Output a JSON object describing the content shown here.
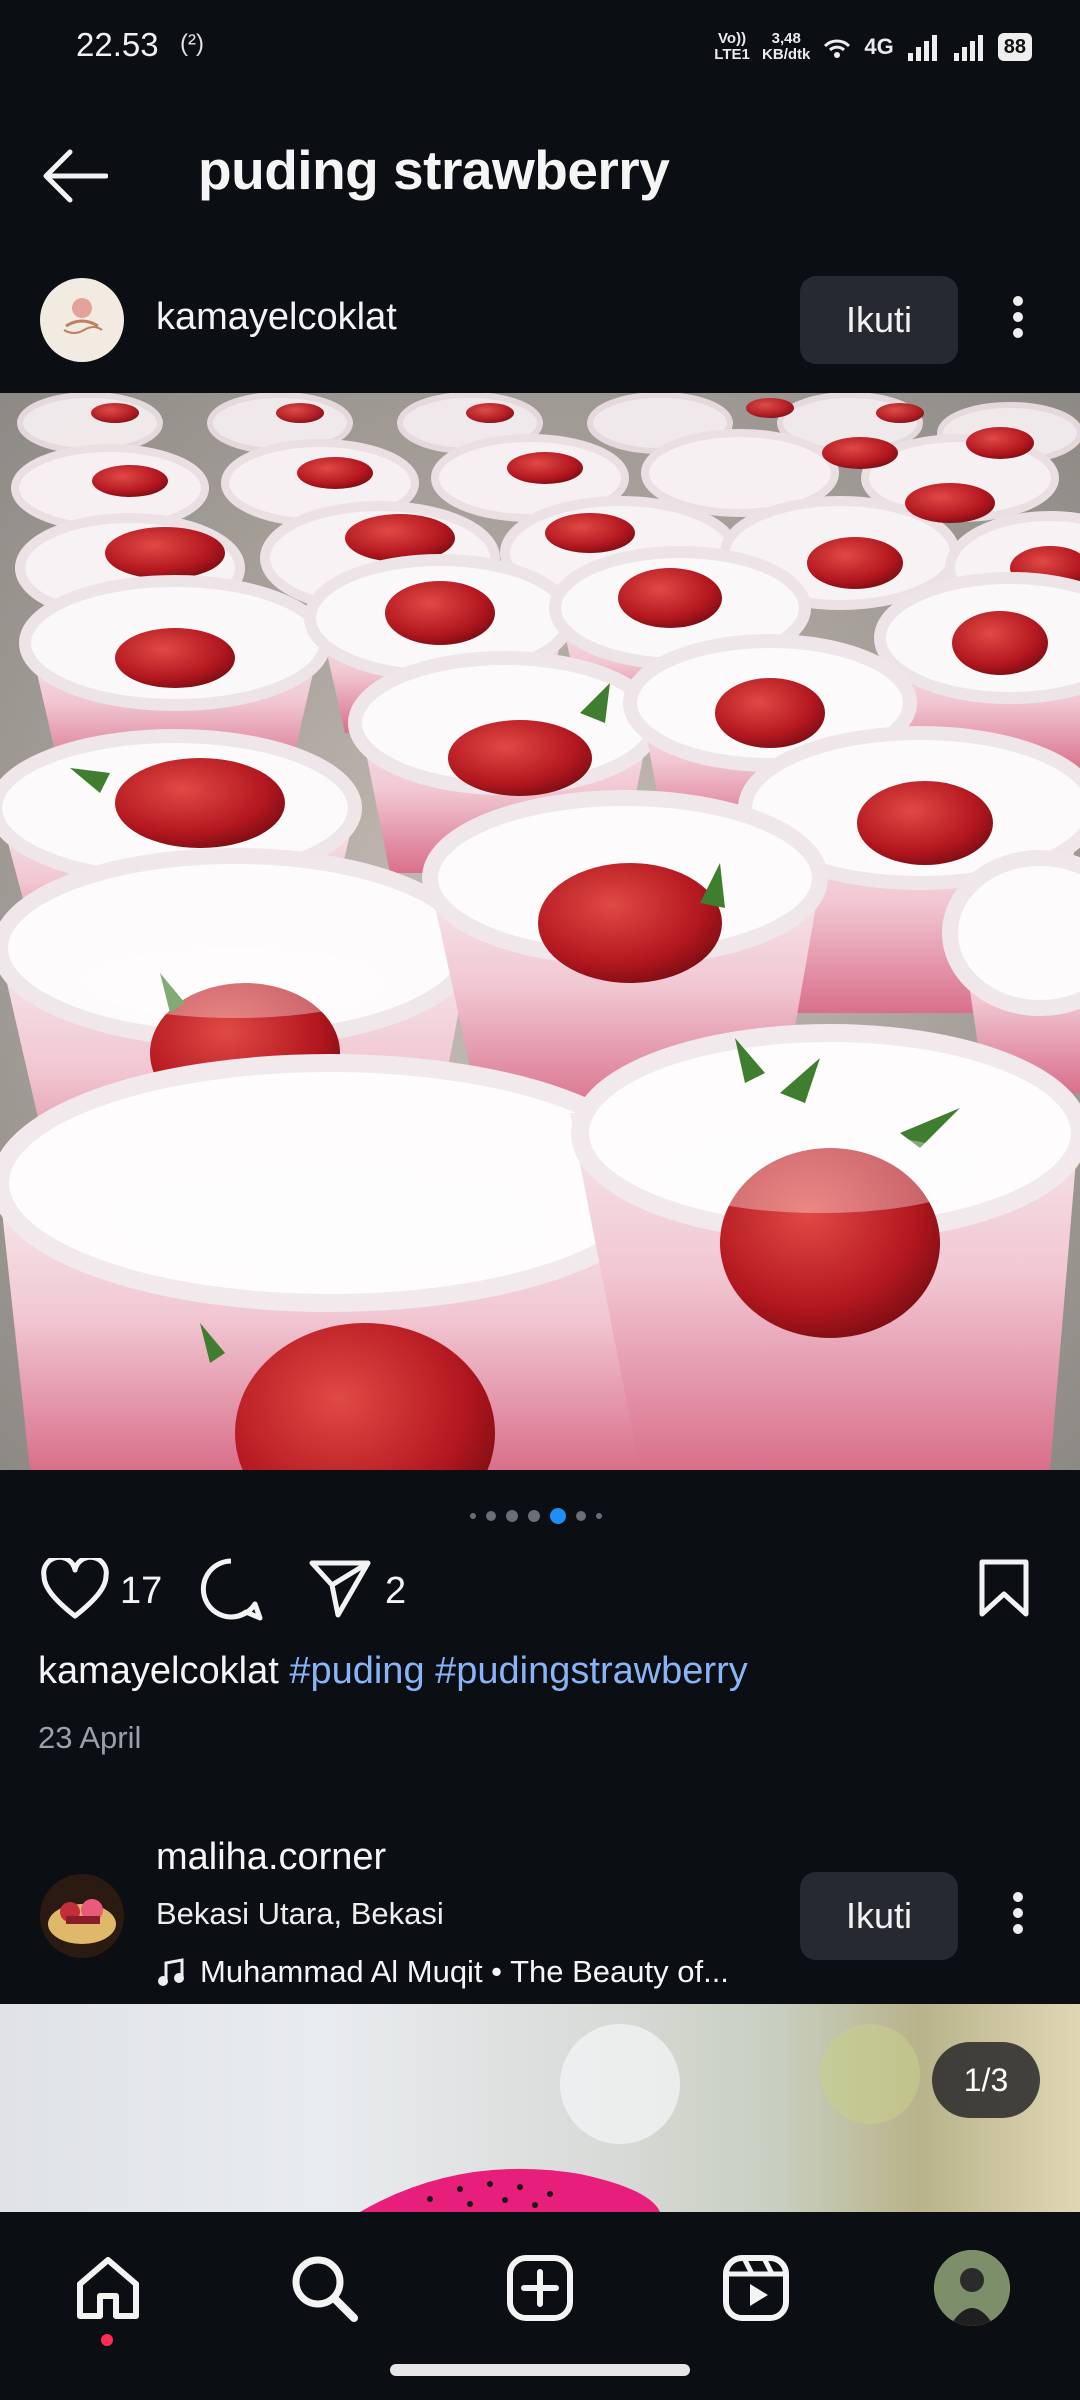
{
  "status_bar": {
    "time": "22.53",
    "hotspot_label": "(²)",
    "volte": "Vo)) LTE1",
    "speed_value": "3,48",
    "speed_unit": "KB/dtk",
    "network": "4G",
    "battery": "88"
  },
  "header": {
    "title": "puding strawberry"
  },
  "post1": {
    "username": "kamayelcoklat",
    "follow_label": "Ikuti",
    "like_count": "17",
    "share_count": "2",
    "caption_user": "kamayelcoklat",
    "hashtags": [
      "#puding",
      "#pudingstrawberry"
    ],
    "date": "23 April",
    "carousel": {
      "total": 7,
      "active_index": 4
    }
  },
  "post2": {
    "username": "maliha.corner",
    "location": "Bekasi Utara, Bekasi",
    "music": "Muhammad Al Muqit • The Beauty of...",
    "follow_label": "Ikuti",
    "image_counter": "1/3"
  },
  "bottom_nav": {
    "items": [
      "home-icon",
      "search-icon",
      "create-icon",
      "reels-icon",
      "profile-avatar"
    ],
    "active": "home"
  },
  "colors": {
    "background": "#0b0f14",
    "button": "#262a30",
    "hashtag": "#8ab4f8",
    "active_dot": "#1f8ff5",
    "notification_dot": "#ff2d55"
  }
}
